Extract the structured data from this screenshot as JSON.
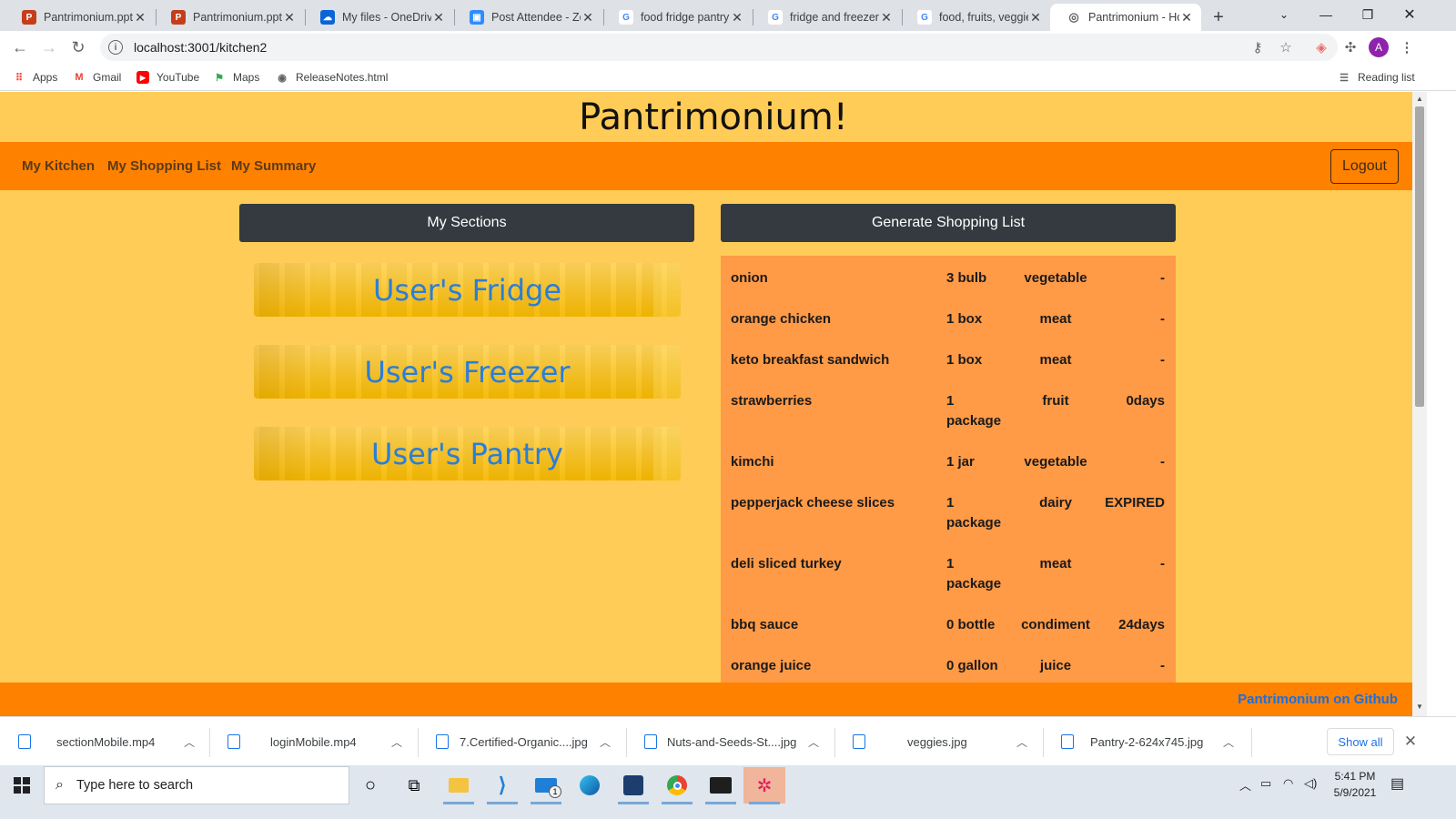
{
  "browser": {
    "tabs": [
      {
        "title": "Pantrimonium.pptx",
        "icon": "powerpoint-icon",
        "color": "#c43e1c",
        "glyph": "P"
      },
      {
        "title": "Pantrimonium.pptx",
        "icon": "powerpoint-icon",
        "color": "#c43e1c",
        "glyph": "P"
      },
      {
        "title": "My files - OneDrive",
        "icon": "onedrive-icon",
        "color": "#0a64d6",
        "glyph": "☁"
      },
      {
        "title": "Post Attendee - Zoom",
        "icon": "zoom-icon",
        "color": "#2d8cff",
        "glyph": "▣"
      },
      {
        "title": "food fridge pantry",
        "icon": "google-icon",
        "color": "#ffffff",
        "glyph": "G"
      },
      {
        "title": "fridge and freezer s",
        "icon": "google-icon",
        "color": "#ffffff",
        "glyph": "G"
      },
      {
        "title": "food, fruits, veggies",
        "icon": "google-icon",
        "color": "#ffffff",
        "glyph": "G"
      },
      {
        "title": "Pantrimonium - Ho",
        "icon": "globe-icon",
        "color": "#ffffff",
        "glyph": "◎",
        "active": true
      }
    ],
    "url": "localhost:3001/kitchen2",
    "profile_initial": "A",
    "bookmarks": {
      "apps": "Apps",
      "gmail": "Gmail",
      "youtube": "YouTube",
      "maps": "Maps",
      "release_notes": "ReleaseNotes.html",
      "reading_list": "Reading list"
    }
  },
  "page": {
    "title": "Pantrimonium!",
    "nav": {
      "my_kitchen": "My Kitchen",
      "my_shopping_list": "My Shopping List",
      "my_summary": "My Summary",
      "logout": "Logout"
    },
    "my_sections_button": "My Sections",
    "generate_button": "Generate Shopping List",
    "sections": [
      "User's Fridge",
      "User's Freezer",
      "User's Pantry"
    ],
    "shopping_list": [
      {
        "name": "onion",
        "qty": "3 bulb",
        "category": "vegetable",
        "expires": "-"
      },
      {
        "name": "orange chicken",
        "qty": "1 box",
        "category": "meat",
        "expires": "-"
      },
      {
        "name": "keto breakfast sandwich",
        "qty": "1 box",
        "category": "meat",
        "expires": "-"
      },
      {
        "name": "strawberries",
        "qty": "1 package",
        "category": "fruit",
        "expires": "0days"
      },
      {
        "name": "kimchi",
        "qty": "1 jar",
        "category": "vegetable",
        "expires": "-"
      },
      {
        "name": "pepperjack cheese slices",
        "qty": "1 package",
        "category": "dairy",
        "expires": "EXPIRED"
      },
      {
        "name": "deli sliced turkey",
        "qty": "1 package",
        "category": "meat",
        "expires": "-"
      },
      {
        "name": "bbq sauce",
        "qty": "0 bottle",
        "category": "condiment",
        "expires": "24days"
      },
      {
        "name": "orange juice",
        "qty": "0 gallon",
        "category": "juice",
        "expires": "-"
      }
    ],
    "footer_link": "Pantrimonium on Github"
  },
  "downloads": {
    "files": [
      "sectionMobile.mp4",
      "loginMobile.mp4",
      "7.Certified-Organic....jpg",
      "Nuts-and-Seeds-St....jpg",
      "veggies.jpg",
      "Pantry-2-624x745.jpg"
    ],
    "show_all": "Show all"
  },
  "taskbar": {
    "search_placeholder": "Type here to search",
    "time": "5:41 PM",
    "date": "5/9/2021",
    "mail_badge": "1"
  },
  "colors": {
    "page_bg": "#ffcc57",
    "nav_bg": "#ff8100",
    "list_bg": "#ff9a46",
    "dark_button": "#343a40",
    "section_link": "#2a7ed8",
    "footer_link": "#1a6fe0"
  }
}
